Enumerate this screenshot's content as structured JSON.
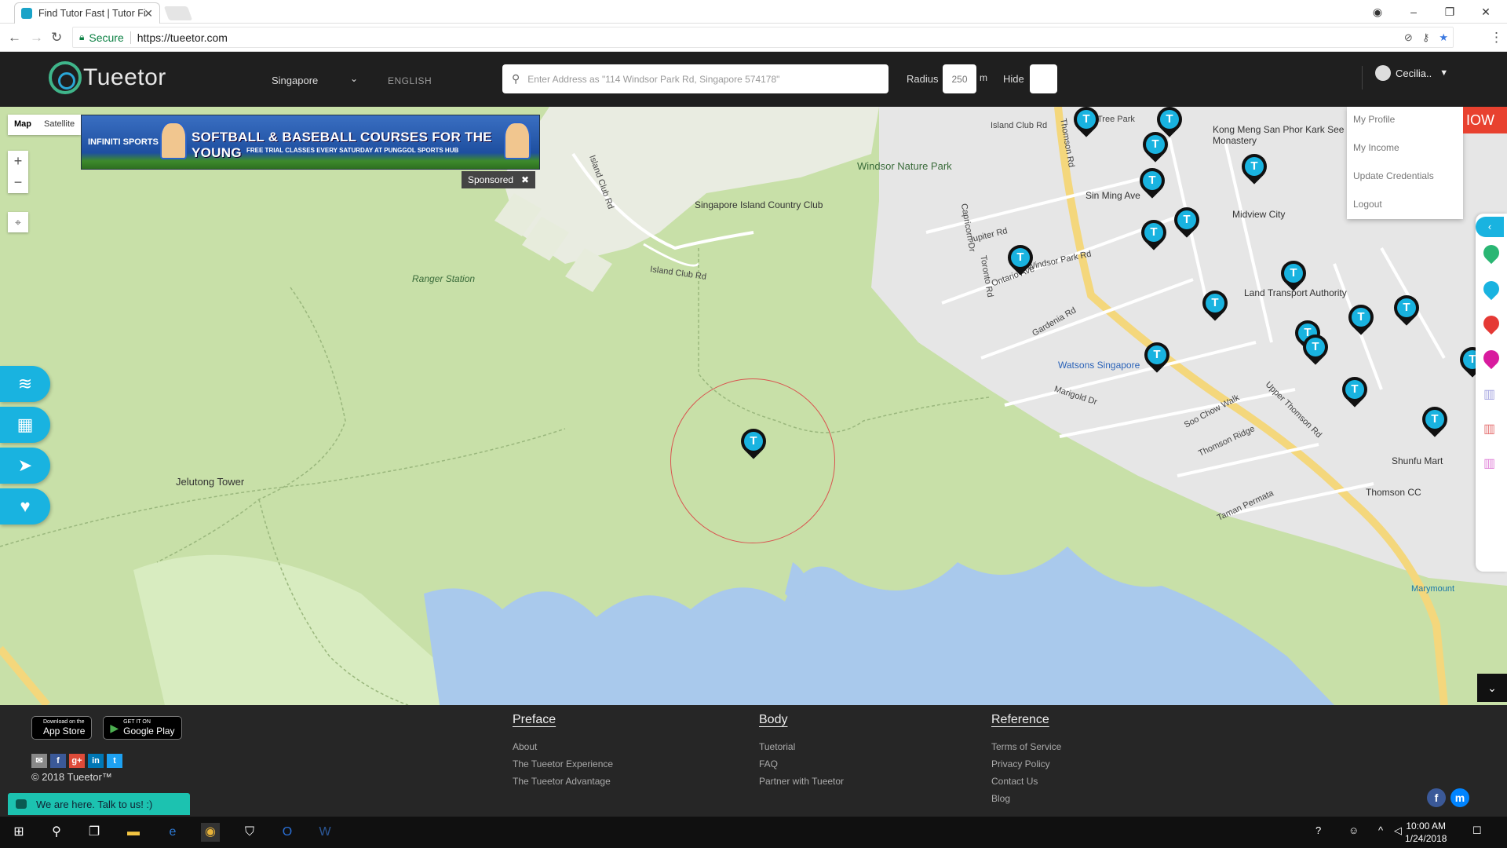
{
  "browser": {
    "tab_title": "Find Tutor Fast | Tutor Fi",
    "secure_label": "Secure",
    "url": "https://tueetor.com"
  },
  "header": {
    "brand": "Tueetor",
    "country": "Singapore",
    "language": "ENGLISH",
    "search_placeholder": "Enter Address as \"114 Windsor Park Rd, Singapore 574178\"",
    "radius_label": "Radius",
    "radius_value": "250",
    "radius_unit": "m",
    "hide_label": "Hide",
    "user_name": "Cecilia.."
  },
  "map": {
    "maptype_map": "Map",
    "maptype_satellite": "Satellite",
    "ad": {
      "brand": "INFINITI SPORTS",
      "headline": "SOFTBALL & BASEBALL COURSES FOR THE YOUNG",
      "sub": "FREE TRIAL CLASSES EVERY SATURDAY AT PUNGGOL SPORTS HUB"
    },
    "sponsored_label": "Sponsored",
    "labels": {
      "island_club_rd_n": "Island Club Rd",
      "island_club_rd_w": "Island Club Rd",
      "island_club_rd_s": "Island Club Rd",
      "windsor_nature_park": "Windsor Nature Park",
      "singapore_island_country_club": "Singapore Island Country Club",
      "ranger_station": "Ranger Station",
      "jelutong_tower": "Jelutong Tower",
      "thomson_rd": "Thomson Rd",
      "upper_thomson_rd": "Upper Thomson Rd",
      "kong_meng": "Kong Meng San Phor Kark See Monastery",
      "sin_ming_ave": "Sin Ming Ave",
      "midview_city": "Midview City",
      "land_transport_authority": "Land Transport Authority",
      "watsons_singapore": "Watsons Singapore",
      "shunfu_mart": "Shunfu Mart",
      "thomson_cc": "Thomson CC",
      "windsor_park_rd": "Windsor Park Rd",
      "jupiter_rd": "Jupiter Rd",
      "ontario_ave": "Ontario Ave",
      "gardenia_rd": "Gardenia Rd",
      "marigold_dr": "Marigold Dr",
      "soo_chow_walk": "Soo Chow Walk",
      "thomson_ridge": "Thomson Ridge",
      "taman_permata": "Taman Permata",
      "marymount": "Marymount",
      "tree_park": "Tree Park",
      "capricorn_dr": "Capricorn Dr",
      "toronto_rd": "Toronto Rd"
    },
    "user_menu": [
      "My Profile",
      "My Income",
      "Update Credentials",
      "Logout"
    ],
    "now_banner": "IOW",
    "colors": {
      "pin_tutor": "#19b3e0",
      "rail_pin_green": "#2ab673",
      "rail_pin_blue": "#19b3e0",
      "rail_pin_red": "#e53935",
      "rail_pin_magenta": "#d81b9e"
    }
  },
  "footer": {
    "app_store_small": "Download on the",
    "app_store": "App Store",
    "google_play_small": "GET IT ON",
    "google_play": "Google Play",
    "copyright": "© 2018 Tueetor™",
    "preface": {
      "title": "Preface",
      "links": [
        "About",
        "The Tueetor Experience",
        "The Tueetor Advantage"
      ]
    },
    "body": {
      "title": "Body",
      "links": [
        "Tuetorial",
        "FAQ",
        "Partner with Tueetor"
      ]
    },
    "reference": {
      "title": "Reference",
      "links": [
        "Terms of Service",
        "Privacy Policy",
        "Contact Us",
        "Blog"
      ]
    },
    "chat": "We are here. Talk to us! :)"
  },
  "taskbar": {
    "time": "10:00 AM",
    "date": "1/24/2018"
  }
}
